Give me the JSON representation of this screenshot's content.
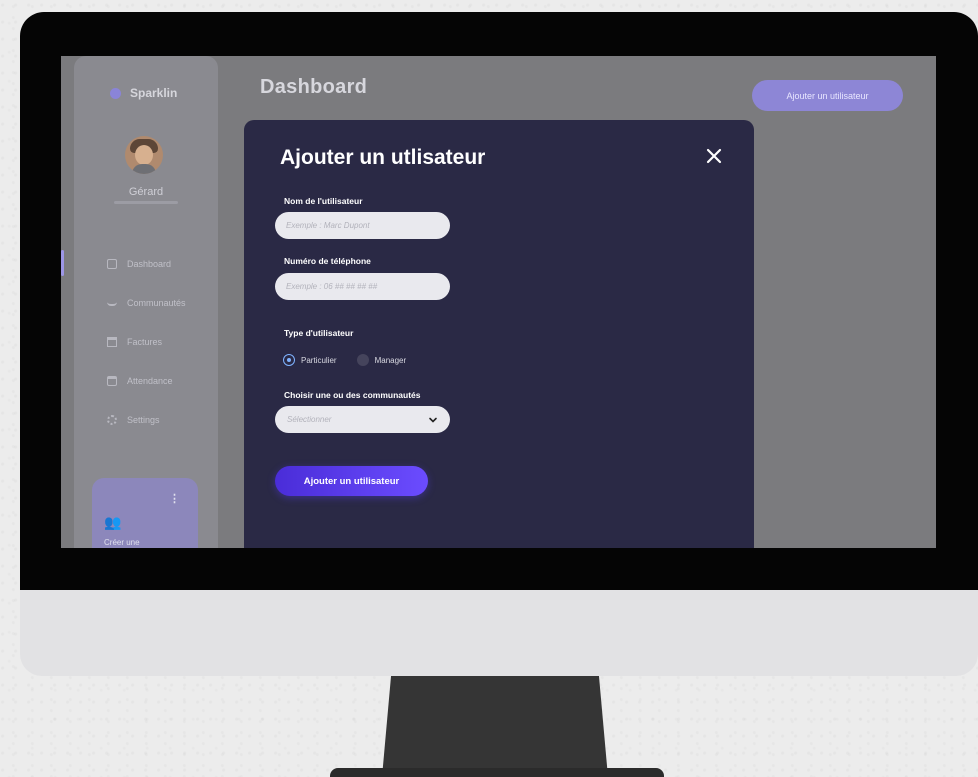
{
  "app": {
    "brand": "Sparklin",
    "page_title": "Dashboard",
    "top_button": "Ajouter un utilisateur"
  },
  "user": {
    "name": "Gérard"
  },
  "sidebar": {
    "items": [
      {
        "label": "Dashboard",
        "icon": "dashboard-icon",
        "active": true
      },
      {
        "label": "Communautés",
        "icon": "people-icon",
        "active": false
      },
      {
        "label": "Factures",
        "icon": "invoice-icon",
        "active": false
      },
      {
        "label": "Attendance",
        "icon": "calendar-icon",
        "active": false
      },
      {
        "label": "Settings",
        "icon": "gear-icon",
        "active": false
      }
    ],
    "create_card": {
      "label": "Créer une",
      "icon": "group-icon"
    }
  },
  "modal": {
    "title": "Ajouter un utlisateur",
    "close_icon": "close-icon",
    "fields": {
      "name_label": "Nom de l'utilisateur",
      "name_placeholder": "Exemple : Marc Dupont",
      "name_value": "",
      "phone_label": "Numéro de téléphone",
      "phone_placeholder": "Exemple : 06 ## ## ## ##",
      "phone_value": ""
    },
    "type": {
      "label": "Type d'utilisateur",
      "options": [
        "Particulier",
        "Manager"
      ],
      "selected": "Particulier"
    },
    "communities": {
      "label": "Choisir une ou des communautés",
      "placeholder": "Sélectionner"
    },
    "submit_label": "Ajouter un utilisateur"
  },
  "colors": {
    "modal_bg": "#2a2945",
    "accent": "#5b3cf0",
    "radio_active": "#7fb3ff"
  }
}
